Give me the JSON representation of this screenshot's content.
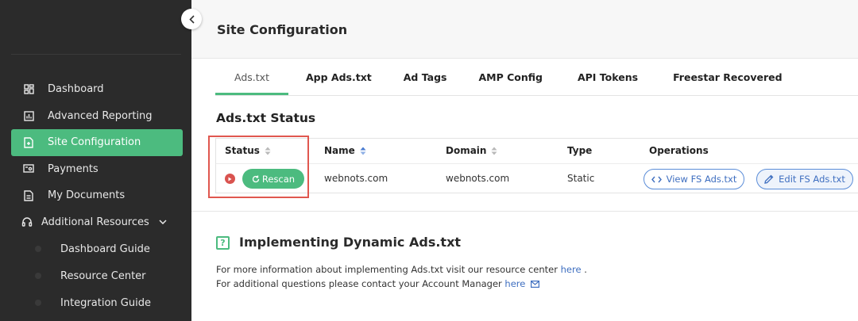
{
  "sidebar": {
    "items": [
      {
        "label": "Dashboard",
        "icon": "dashboard-icon"
      },
      {
        "label": "Advanced Reporting",
        "icon": "report-icon"
      },
      {
        "label": "Site Configuration",
        "icon": "file-icon",
        "active": true
      },
      {
        "label": "Payments",
        "icon": "payments-icon"
      },
      {
        "label": "My Documents",
        "icon": "document-icon"
      },
      {
        "label": "Additional Resources",
        "icon": "headset-icon"
      }
    ],
    "sub_items": [
      {
        "label": "Dashboard Guide"
      },
      {
        "label": "Resource Center"
      },
      {
        "label": "Integration Guide"
      }
    ]
  },
  "header": {
    "title": "Site Configuration"
  },
  "tabs": [
    {
      "label": "Ads.txt",
      "active": true
    },
    {
      "label": "App Ads.txt"
    },
    {
      "label": "Ad Tags"
    },
    {
      "label": "AMP Config"
    },
    {
      "label": "API Tokens"
    },
    {
      "label": "Freestar Recovered"
    }
  ],
  "status_section": {
    "title": "Ads.txt Status"
  },
  "table": {
    "columns": [
      "Status",
      "Name",
      "Domain",
      "Type",
      "Operations"
    ],
    "row": {
      "rescan_label": "Rescan",
      "name": "webnots.com",
      "domain": "webnots.com",
      "type": "Static",
      "view_label": "View FS Ads.txt",
      "edit_label": "Edit FS Ads.txt"
    }
  },
  "info": {
    "icon_glyph": "?",
    "title": "Implementing Dynamic Ads.txt",
    "line1_text": "For more information about implementing Ads.txt visit our resource center",
    "line1_link": "here",
    "line1_suffix": ".",
    "line2_text": "For additional questions please contact your Account Manager",
    "line2_link": "here"
  },
  "colors": {
    "accent": "#4cbb7f",
    "sidebar_bg": "#2b2b2b",
    "link": "#3f6fc0",
    "status_error": "#d9534f",
    "highlight": "#e0574f"
  }
}
